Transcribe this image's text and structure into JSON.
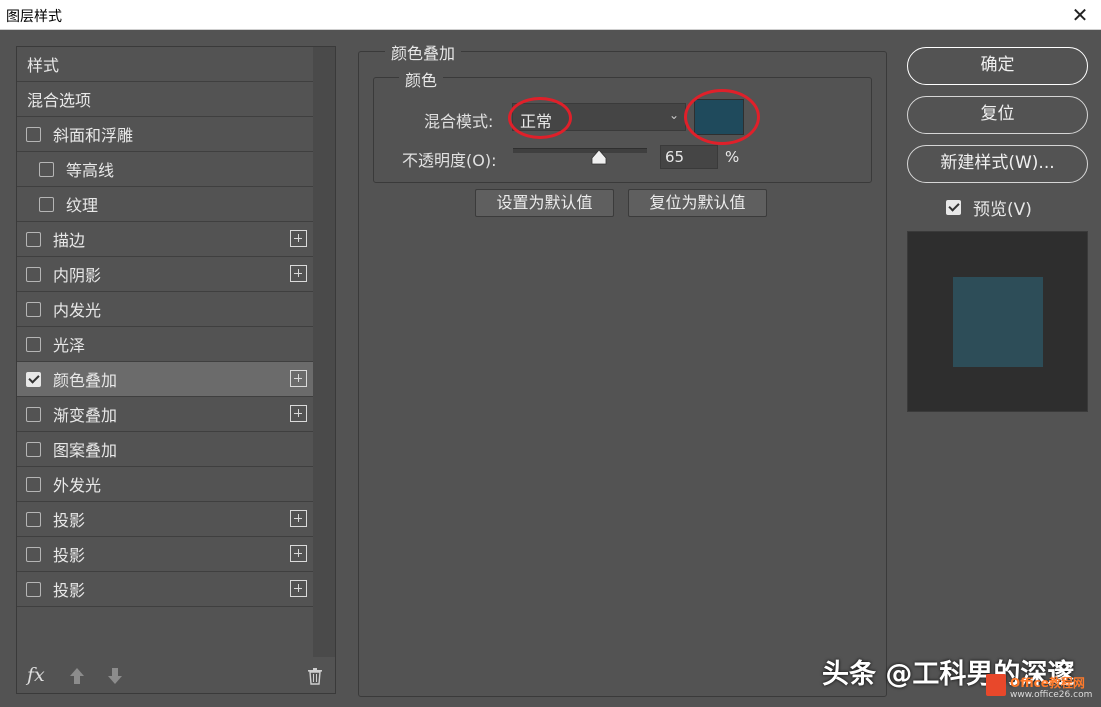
{
  "window": {
    "title": "图层样式",
    "close_glyph": "✕"
  },
  "styles_list": {
    "headers": [
      "样式",
      "混合选项"
    ],
    "items": [
      {
        "label": "斜面和浮雕",
        "checked": false,
        "plus": false,
        "sub": false
      },
      {
        "label": "等高线",
        "checked": false,
        "plus": false,
        "sub": true
      },
      {
        "label": "纹理",
        "checked": false,
        "plus": false,
        "sub": true
      },
      {
        "label": "描边",
        "checked": false,
        "plus": true,
        "sub": false
      },
      {
        "label": "内阴影",
        "checked": false,
        "plus": true,
        "sub": false
      },
      {
        "label": "内发光",
        "checked": false,
        "plus": false,
        "sub": false
      },
      {
        "label": "光泽",
        "checked": false,
        "plus": false,
        "sub": false
      },
      {
        "label": "颜色叠加",
        "checked": true,
        "plus": true,
        "sub": false,
        "active": true
      },
      {
        "label": "渐变叠加",
        "checked": false,
        "plus": true,
        "sub": false
      },
      {
        "label": "图案叠加",
        "checked": false,
        "plus": false,
        "sub": false
      },
      {
        "label": "外发光",
        "checked": false,
        "plus": false,
        "sub": false
      },
      {
        "label": "投影",
        "checked": false,
        "plus": true,
        "sub": false
      },
      {
        "label": "投影",
        "checked": false,
        "plus": true,
        "sub": false
      },
      {
        "label": "投影",
        "checked": false,
        "plus": true,
        "sub": false
      }
    ],
    "bottom": {
      "fx_label": "fx",
      "icons": [
        "move-up-icon",
        "move-down-icon",
        "trash-icon"
      ]
    }
  },
  "color_overlay": {
    "section_title": "颜色叠加",
    "group_title": "颜色",
    "blend_mode_label": "混合模式:",
    "blend_mode_value": "正常",
    "color_swatch": "#1f4a5c",
    "opacity_label": "不透明度(O):",
    "opacity_value": "65",
    "opacity_unit": "%",
    "set_default_label": "设置为默认值",
    "reset_default_label": "复位为默认值"
  },
  "actions": {
    "ok_label": "确定",
    "reset_label": "复位",
    "new_style_label": "新建样式(W)...",
    "preview_label": "预览(V)",
    "preview_checked": true,
    "preview_color": "#2d4d58"
  },
  "watermark": {
    "text": "头条 @工科男的深邃",
    "logo_text": "Office教程网",
    "logo_url": "www.office26.com"
  },
  "colors": {
    "annotation_ring": "#e0202a",
    "panel_bg": "#535353"
  }
}
